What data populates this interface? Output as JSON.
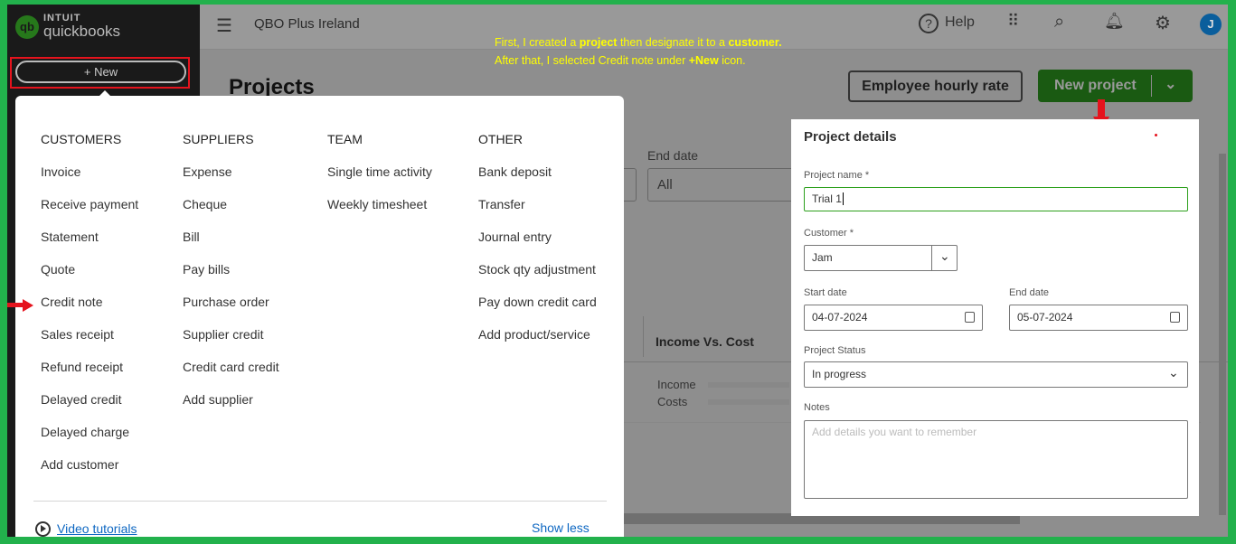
{
  "sidebar": {
    "brand_top": "INTUIT",
    "brand": "quickbooks",
    "logo_mark": "qb",
    "new_label": "+  New"
  },
  "topbar": {
    "company": "QBO Plus Ireland",
    "help": "Help",
    "avatar": "J"
  },
  "annotation": {
    "p1": "First, I created a ",
    "b1": "project",
    "p2": " then designate it to a ",
    "b2": "customer.",
    "p3": " After that, I selected Credit note under ",
    "b3": "+New",
    "p4": " icon."
  },
  "page": {
    "title": "Projects",
    "employee_rate": "Employee hourly rate",
    "new_project": "New project",
    "end_date_label": "End date",
    "end_date_value": "All",
    "income_vs_cost": "Income Vs. Cost",
    "income": "Income",
    "costs": "Costs"
  },
  "menu": {
    "columns": [
      {
        "header": "CUSTOMERS",
        "items": [
          "Invoice",
          "Receive payment",
          "Statement",
          "Quote",
          "Credit note",
          "Sales receipt",
          "Refund receipt",
          "Delayed credit",
          "Delayed charge",
          "Add customer"
        ]
      },
      {
        "header": "SUPPLIERS",
        "items": [
          "Expense",
          "Cheque",
          "Bill",
          "Pay bills",
          "Purchase order",
          "Supplier credit",
          "Credit card credit",
          "Add supplier"
        ]
      },
      {
        "header": "TEAM",
        "items": [
          "Single time activity",
          "Weekly timesheet"
        ]
      },
      {
        "header": "OTHER",
        "items": [
          "Bank deposit",
          "Transfer",
          "Journal entry",
          "Stock qty adjustment",
          "Pay down credit card",
          "Add product/service"
        ]
      }
    ],
    "video_tutorials": "Video tutorials",
    "show_less": "Show less"
  },
  "panel": {
    "title": "Project details",
    "project_name_label": "Project name *",
    "project_name": "Trial 1",
    "customer_label": "Customer *",
    "customer": "Jam",
    "start_label": "Start date",
    "start": "04-07-2024",
    "end_label": "End date",
    "end": "05-07-2024",
    "status_label": "Project Status",
    "status": "In progress",
    "notes_label": "Notes",
    "notes_placeholder": "Add details you want to remember"
  }
}
